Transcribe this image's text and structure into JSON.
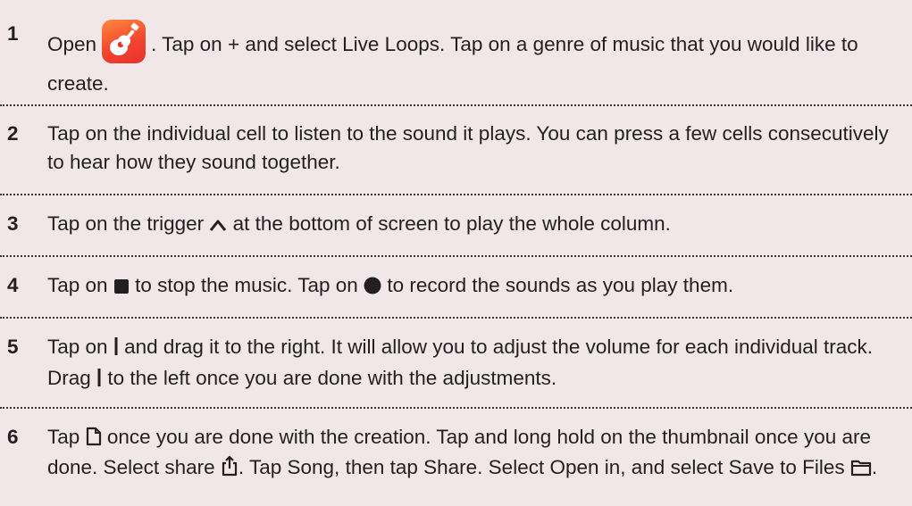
{
  "steps": [
    {
      "number": "1",
      "part1": "Open",
      "part2": ". Tap on + and select Live Loops. Tap on a genre of music that you would like to create.",
      "app_icon": "garageband-guitar-icon"
    },
    {
      "number": "2",
      "text": "Tap on the individual cell to listen to the sound it plays. You can press a few cells consecutively to hear how they sound together."
    },
    {
      "number": "3",
      "part1": "Tap on the trigger",
      "part2": "at the bottom of screen to play the whole column.",
      "icon": "caret-up-icon"
    },
    {
      "number": "4",
      "part1": "Tap on",
      "part2": "to stop the music. Tap on",
      "part3": "to record the sounds as you play them.",
      "icons": [
        "stop-square-icon",
        "record-circle-icon"
      ]
    },
    {
      "number": "5",
      "part1": "Tap on",
      "part2": "and drag it to the right. It will allow you to adjust the volume for each individual track. Drag",
      "part3": "to the left once you are done with the adjustments.",
      "icons": [
        "divider-bar-icon",
        "divider-bar-icon"
      ]
    },
    {
      "number": "6",
      "part1": "Tap",
      "part2": "once you are done with the creation. Tap and long hold on the thumbnail once you are done. Select share",
      "part3": ". Tap Song, then tap Share. Select Open in, and select Save to Files",
      "part4": ".",
      "icons": [
        "document-icon",
        "share-icon",
        "folder-icon"
      ]
    }
  ]
}
